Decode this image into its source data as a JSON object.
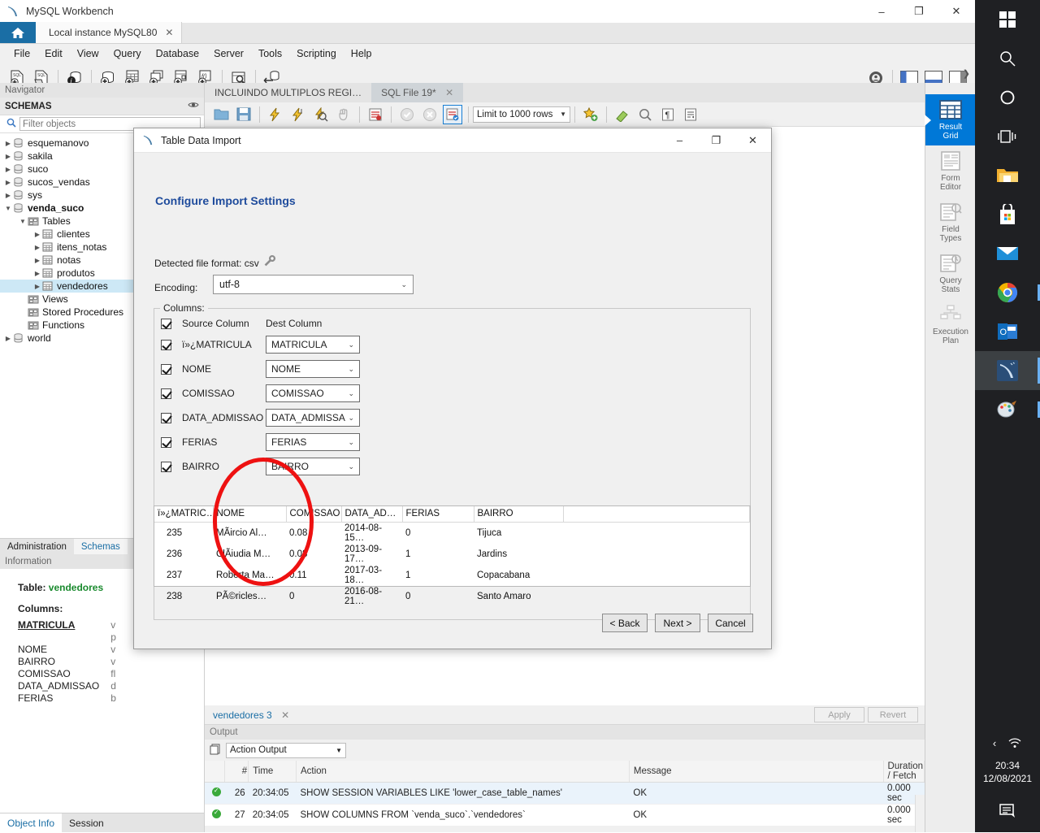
{
  "window": {
    "title": "MySQL Workbench",
    "minimize": "–",
    "maximize": "❐",
    "close": "✕"
  },
  "tabs": {
    "connection_tab": "Local instance MySQL80",
    "close_glyph": "✕"
  },
  "menu": [
    "File",
    "Edit",
    "View",
    "Query",
    "Database",
    "Server",
    "Tools",
    "Scripting",
    "Help"
  ],
  "navigator": {
    "header": "Navigator",
    "schemas_label": "SCHEMAS",
    "filter_placeholder": "Filter objects",
    "filter_value": "",
    "tree": [
      {
        "label": "esquemanovo",
        "depth": 1,
        "icon": "schema-icon",
        "expanded": false,
        "bold": false
      },
      {
        "label": "sakila",
        "depth": 1,
        "icon": "schema-icon",
        "expanded": false,
        "bold": false
      },
      {
        "label": "suco",
        "depth": 1,
        "icon": "schema-icon",
        "expanded": false,
        "bold": false
      },
      {
        "label": "sucos_vendas",
        "depth": 1,
        "icon": "schema-icon",
        "expanded": false,
        "bold": false
      },
      {
        "label": "sys",
        "depth": 1,
        "icon": "schema-icon",
        "expanded": false,
        "bold": false
      },
      {
        "label": "venda_suco",
        "depth": 1,
        "icon": "schema-icon",
        "expanded": true,
        "bold": true
      },
      {
        "label": "Tables",
        "depth": 2,
        "icon": "folder-icon",
        "expanded": true,
        "bold": false
      },
      {
        "label": "clientes",
        "depth": 3,
        "icon": "table-icon",
        "expanded": false,
        "bold": false
      },
      {
        "label": "itens_notas",
        "depth": 3,
        "icon": "table-icon",
        "expanded": false,
        "bold": false
      },
      {
        "label": "notas",
        "depth": 3,
        "icon": "table-icon",
        "expanded": false,
        "bold": false
      },
      {
        "label": "produtos",
        "depth": 3,
        "icon": "table-icon",
        "expanded": false,
        "bold": false
      },
      {
        "label": "vendedores",
        "depth": 3,
        "icon": "table-icon",
        "expanded": false,
        "bold": false,
        "selected": true
      },
      {
        "label": "Views",
        "depth": 2,
        "icon": "folder-icon",
        "expanded": null,
        "bold": false
      },
      {
        "label": "Stored Procedures",
        "depth": 2,
        "icon": "folder-icon",
        "expanded": null,
        "bold": false
      },
      {
        "label": "Functions",
        "depth": 2,
        "icon": "folder-icon",
        "expanded": null,
        "bold": false
      },
      {
        "label": "world",
        "depth": 1,
        "icon": "schema-icon",
        "expanded": false,
        "bold": false
      }
    ],
    "bottom_tabs": [
      {
        "label": "Administration",
        "active": false
      },
      {
        "label": "Schemas",
        "active": true
      }
    ]
  },
  "information": {
    "header": "Information",
    "table_label": "Table:",
    "table_name": "vendedores",
    "columns_label": "Columns:",
    "columns": [
      {
        "name": "MATRICULA",
        "type": "v",
        "pk": true
      },
      {
        "name": "",
        "type": "p",
        "pk": false
      },
      {
        "name": "NOME",
        "type": "v",
        "pk": false
      },
      {
        "name": "BAIRRO",
        "type": "v",
        "pk": false
      },
      {
        "name": "COMISSAO",
        "type": "fl",
        "pk": false
      },
      {
        "name": "DATA_ADMISSAO",
        "type": "d",
        "pk": false
      },
      {
        "name": "FERIAS",
        "type": "b",
        "pk": false
      }
    ],
    "bottom_tabs": [
      {
        "label": "Object Info",
        "active": true
      },
      {
        "label": "Session",
        "active": false
      }
    ]
  },
  "editor": {
    "tabs": [
      {
        "label": "INCLUINDO  MULTIPLOS REGI…",
        "active": false,
        "closable": false
      },
      {
        "label": "SQL File 19*",
        "active": true,
        "closable": true
      }
    ],
    "limit_label": "Limit to 1000 rows",
    "expander": "❯"
  },
  "side_strip": [
    {
      "label_line1": "Result",
      "label_line2": "Grid",
      "icon": "grid-icon",
      "active": true
    },
    {
      "label_line1": "Form",
      "label_line2": "Editor",
      "icon": "form-icon",
      "active": false
    },
    {
      "label_line1": "Field",
      "label_line2": "Types",
      "icon": "field-types-icon",
      "active": false
    },
    {
      "label_line1": "Query",
      "label_line2": "Stats",
      "icon": "query-stats-icon",
      "active": false
    },
    {
      "label_line1": "Execution",
      "label_line2": "Plan",
      "icon": "execution-plan-icon",
      "active": false
    }
  ],
  "result_panel": {
    "tab_label": "vendedores 3",
    "close_glyph": "✕",
    "apply_label": "Apply",
    "revert_label": "Revert"
  },
  "output": {
    "header": "Output",
    "selector_value": "Action Output",
    "columns": [
      "#",
      "Time",
      "Action",
      "Message",
      "Duration / Fetch"
    ],
    "rows": [
      {
        "num": "26",
        "time": "20:34:05",
        "action": "SHOW SESSION VARIABLES LIKE 'lower_case_table_names'",
        "message": "OK",
        "duration": "0.000 sec"
      },
      {
        "num": "27",
        "time": "20:34:05",
        "action": "SHOW COLUMNS FROM `venda_suco`.`vendedores`",
        "message": "OK",
        "duration": "0.000 sec"
      }
    ]
  },
  "dialog": {
    "title": "Table Data Import",
    "minimize": "–",
    "maximize": "❐",
    "close": "✕",
    "heading": "Configure Import Settings",
    "detected_format": "Detected file format: csv",
    "encoding_label": "Encoding:",
    "encoding_value": "utf-8",
    "columns_legend": "Columns:",
    "source_header": "Source Column",
    "dest_header": "Dest Column",
    "mappings": [
      {
        "source": "ï»¿MATRICULA",
        "dest": "MATRICULA",
        "checked": true
      },
      {
        "source": "NOME",
        "dest": "NOME",
        "checked": true
      },
      {
        "source": "COMISSAO",
        "dest": "COMISSAO",
        "checked": true
      },
      {
        "source": "DATA_ADMISSAO",
        "dest": "DATA_ADMISSA",
        "checked": true
      },
      {
        "source": "FERIAS",
        "dest": "FERIAS",
        "checked": true
      },
      {
        "source": "BAIRRO",
        "dest": "BAIRRO",
        "checked": true
      }
    ],
    "preview": {
      "columns": [
        "ï»¿MATRIC…",
        "NOME",
        "COMISSAO",
        "DATA_AD…",
        "FERIAS",
        "BAIRRO",
        ""
      ],
      "rows": [
        [
          "235",
          "MÃircio Al…",
          "0.08",
          "2014-08-15…",
          "0",
          "Tijuca",
          ""
        ],
        [
          "236",
          "ClÃiudia M…",
          "0.08",
          "2013-09-17…",
          "1",
          "Jardins",
          ""
        ],
        [
          "237",
          "Roberta Ma…",
          "0.11",
          "2017-03-18…",
          "1",
          "Copacabana",
          ""
        ],
        [
          "238",
          "PÃ©ricles…",
          "0",
          "2016-08-21…",
          "0",
          "Santo Amaro",
          ""
        ]
      ]
    },
    "buttons": {
      "back": "< Back",
      "next": "Next >",
      "cancel": "Cancel"
    },
    "annotation": {
      "shape": "ellipse",
      "color": "#ee1111"
    }
  },
  "taskbar": {
    "icons": [
      "windows-start-icon",
      "search-icon",
      "cortana-icon",
      "task-view-icon",
      "file-explorer-icon",
      "microsoft-store-icon",
      "mail-icon",
      "google-chrome-icon",
      "outlook-icon",
      "mysql-workbench-icon",
      "paint-icon"
    ],
    "tray_chevron": "‹",
    "tray_wifi": "wifi-icon",
    "time": "20:34",
    "date": "12/08/2021",
    "notification": "notification-icon"
  },
  "colors": {
    "accent": "#0078d7",
    "brand_blue": "#1a6ea5",
    "heading_blue": "#1e4b9c",
    "annotation_red": "#ee1111",
    "green": "#1a8a2e"
  }
}
